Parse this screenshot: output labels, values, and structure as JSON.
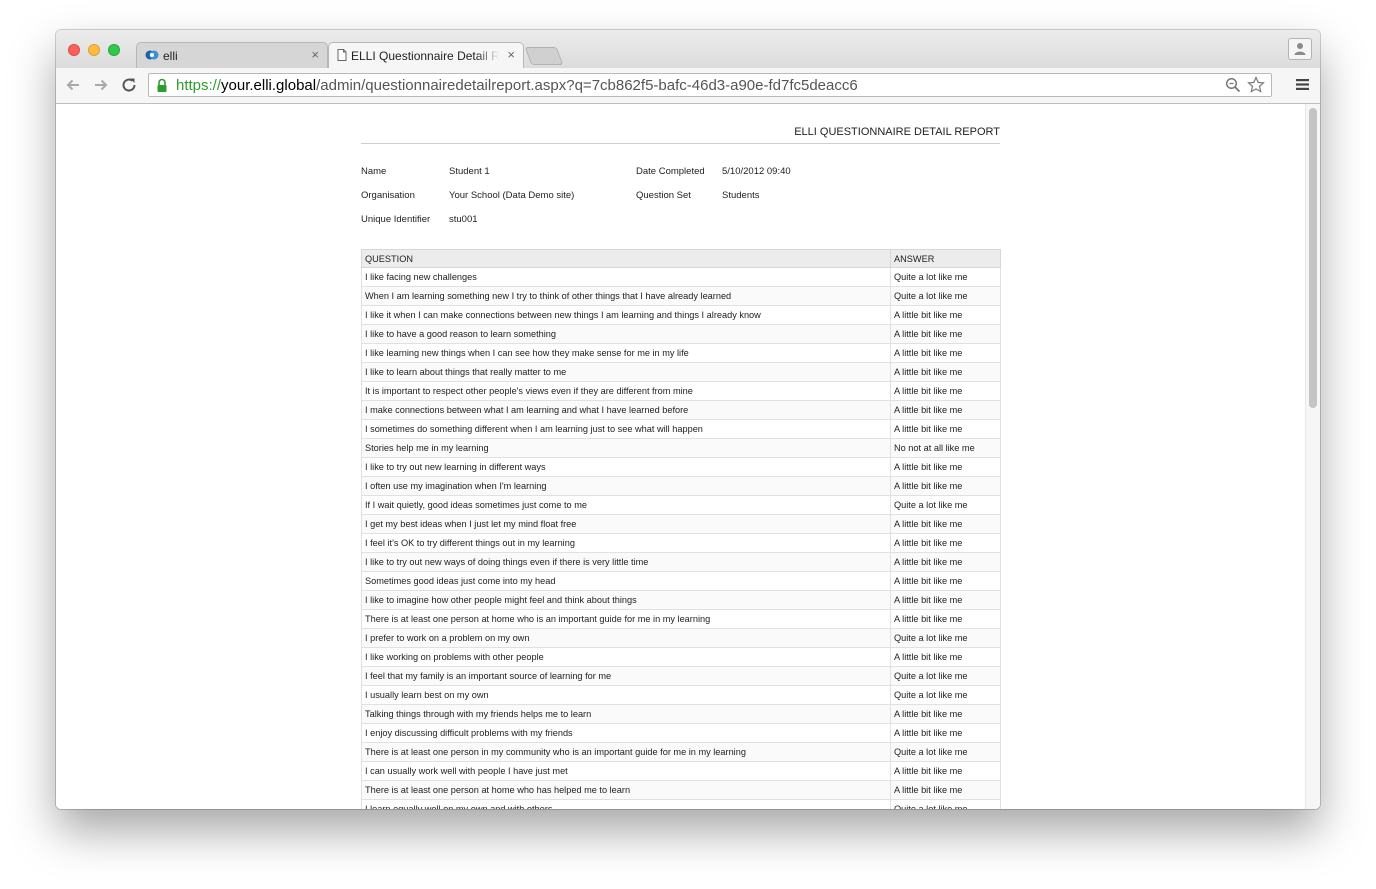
{
  "browser": {
    "tabs": [
      {
        "title": "elli",
        "close": "×"
      },
      {
        "title": "ELLI Questionnaire Detail Report",
        "close": "×"
      }
    ],
    "url": {
      "scheme": "https://",
      "host": "your.elli.global",
      "path": "/admin/questionnairedetailreport.aspx?q=7cb862f5-bafc-46d3-a90e-fd7fc5deacc6"
    }
  },
  "report": {
    "title": "ELLI QUESTIONNAIRE DETAIL REPORT",
    "fields": {
      "name_label": "Name",
      "name_value": "Student 1",
      "org_label": "Organisation",
      "org_value": "Your School (Data Demo site)",
      "uid_label": "Unique Identifier",
      "uid_value": "stu001",
      "date_label": "Date Completed",
      "date_value": "5/10/2012 09:40",
      "qset_label": "Question Set",
      "qset_value": "Students"
    },
    "table": {
      "headers": [
        "QUESTION",
        "ANSWER"
      ],
      "rows": [
        [
          "I like facing new challenges",
          "Quite a lot like me"
        ],
        [
          "When I am learning something new I try to think of other things that I have already learned",
          "Quite a lot like me"
        ],
        [
          "I like it when I can make connections between new things I am learning and things I already know",
          "A little bit like me"
        ],
        [
          "I like to have a good reason to learn something",
          "A little bit like me"
        ],
        [
          "I like learning new things when I can see how they make sense for me in my life",
          "A little bit like me"
        ],
        [
          "I like to learn about things that really matter to me",
          "A little bit like me"
        ],
        [
          "It is important to respect other people's views even if they are different from mine",
          "A little bit like me"
        ],
        [
          "I make connections between what I am learning and what I have learned before",
          "A little bit like me"
        ],
        [
          "I sometimes do something different when I am learning just to see what will happen",
          "A little bit like me"
        ],
        [
          "Stories help me in my learning",
          "No not at all like me"
        ],
        [
          "I like to try out new learning in different ways",
          "A little bit like me"
        ],
        [
          "I often use my imagination when I'm learning",
          "A little bit like me"
        ],
        [
          "If I wait quietly, good ideas sometimes just come to me",
          "Quite a lot like me"
        ],
        [
          "I get my best ideas when I just let my mind float free",
          "A little bit like me"
        ],
        [
          "I feel it's OK to try different things out in my learning",
          "A little bit like me"
        ],
        [
          "I like to try out new ways of doing things even if there is very little time",
          "A little bit like me"
        ],
        [
          "Sometimes good ideas just come into my head",
          "A little bit like me"
        ],
        [
          "I like to imagine how other people might feel and think about things",
          "A little bit like me"
        ],
        [
          "There is at least one person at home who is an important guide for me in my learning",
          "A little bit like me"
        ],
        [
          "I prefer to work on a problem on my own",
          "Quite a lot like me"
        ],
        [
          "I like working on problems with other people",
          "A little bit like me"
        ],
        [
          "I feel that my family is an important source of learning for me",
          "Quite a lot like me"
        ],
        [
          "I usually learn best on my own",
          "Quite a lot like me"
        ],
        [
          "Talking things through with my friends helps me to learn",
          "A little bit like me"
        ],
        [
          "I enjoy discussing difficult problems with my friends",
          "A little bit like me"
        ],
        [
          "There is at least one person in my community who is an important guide for me in my learning",
          "Quite a lot like me"
        ],
        [
          "I can usually work well with people I have just met",
          "A little bit like me"
        ],
        [
          "There is at least one person at home who has helped me to learn",
          "A little bit like me"
        ],
        [
          "I learn equally well on my own and with others",
          "Quite a lot like me"
        ]
      ]
    }
  }
}
